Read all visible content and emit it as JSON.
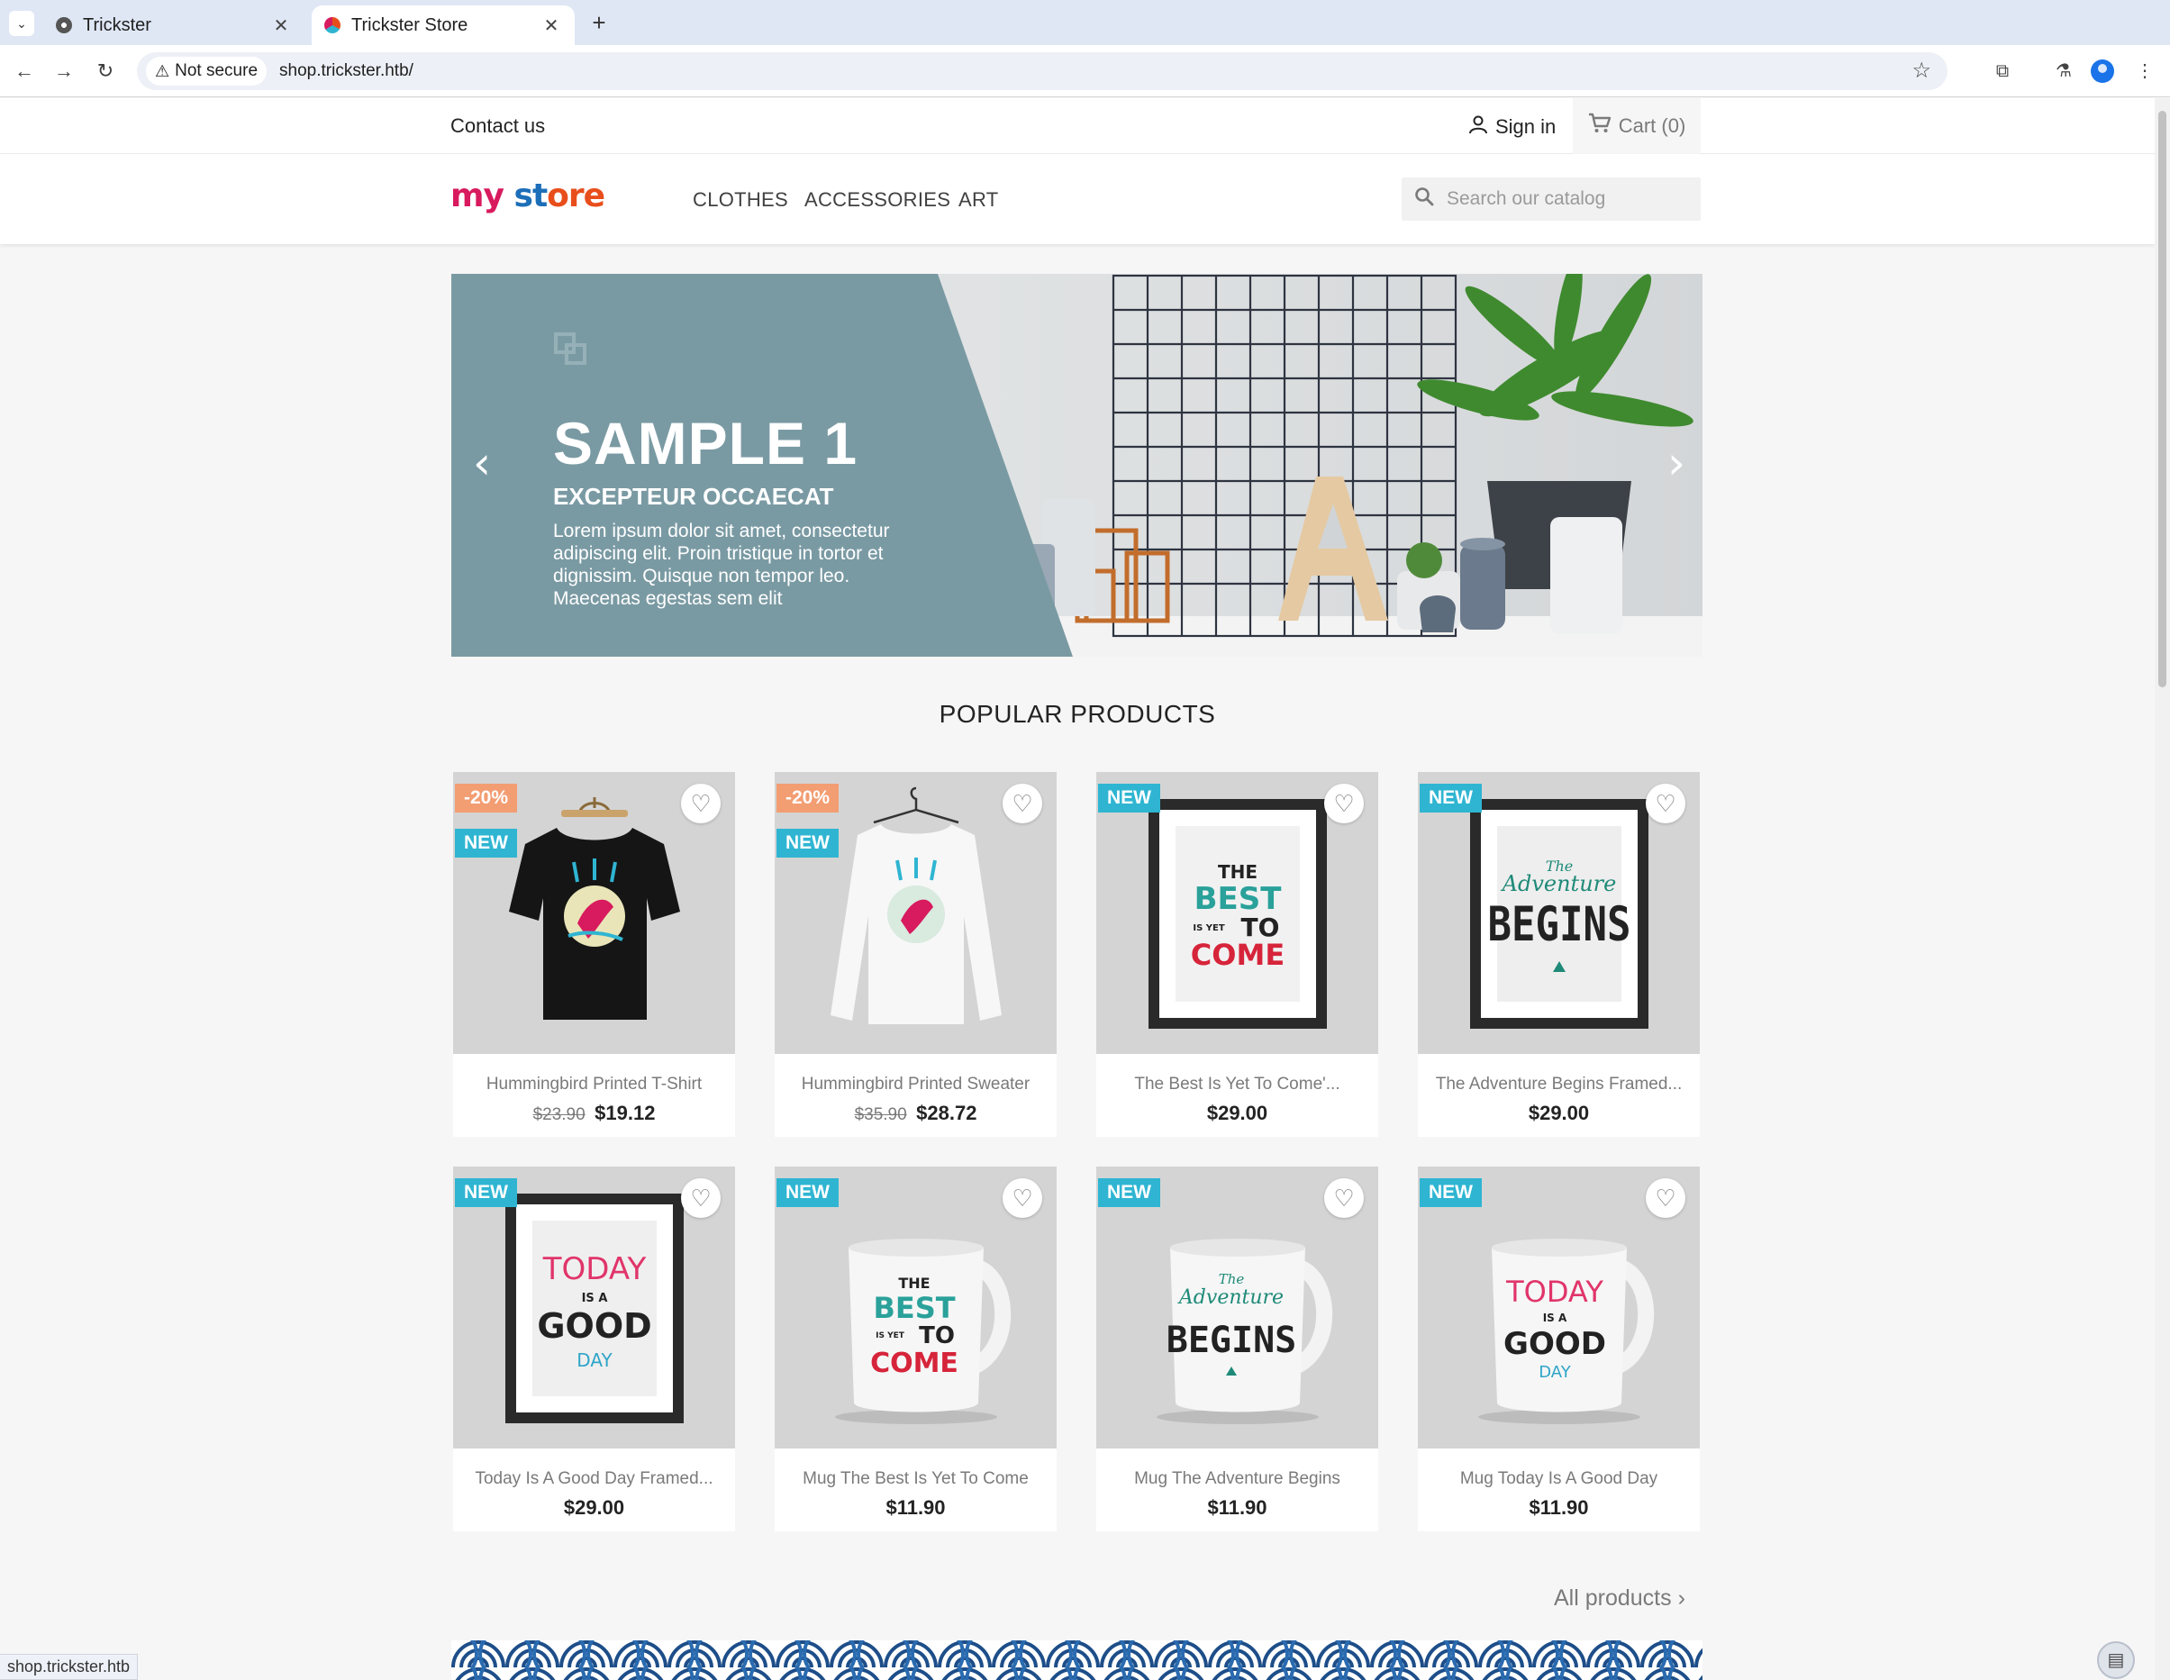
{
  "browser": {
    "tabs": [
      {
        "title": "Trickster",
        "favicon": "globe-icon"
      },
      {
        "title": "Trickster Store",
        "favicon": "store-icon"
      }
    ],
    "security_label": "Not secure",
    "url": "shop.trickster.htb/",
    "status_url": "shop.trickster.htb"
  },
  "header": {
    "contact": "Contact us",
    "sign_in": "Sign in",
    "cart": "Cart (0)"
  },
  "logo": {
    "part1": "my",
    "part2": "st",
    "part3": "ore"
  },
  "menu": [
    "CLOTHES",
    "ACCESSORIES",
    "ART"
  ],
  "search": {
    "placeholder": "Search our catalog",
    "value": ""
  },
  "slider": {
    "title": "SAMPLE 1",
    "subtitle": "EXCEPTEUR OCCAECAT",
    "text": "Lorem ipsum dolor sit amet, consectetur adipiscing elit. Proin tristique in tortor et dignissim. Quisque non tempor leo. Maecenas egestas sem elit",
    "prev_arrow": "‹",
    "next_arrow": "›",
    "panel_color": "#7a9aa3"
  },
  "section_title": "POPULAR PRODUCTS",
  "products": [
    {
      "name": "Hummingbird Printed T-Shirt",
      "old_price": "$23.90",
      "price": "$19.12",
      "discount": "-20%",
      "new": "NEW"
    },
    {
      "name": "Hummingbird Printed Sweater",
      "old_price": "$35.90",
      "price": "$28.72",
      "discount": "-20%",
      "new": "NEW"
    },
    {
      "name": "The Best Is Yet To Come'...",
      "price": "$29.00",
      "new": "NEW"
    },
    {
      "name": "The Adventure Begins Framed...",
      "price": "$29.00",
      "new": "NEW"
    },
    {
      "name": "Today Is A Good Day Framed...",
      "price": "$29.00",
      "new": "NEW"
    },
    {
      "name": "Mug The Best Is Yet To Come",
      "price": "$11.90",
      "new": "NEW"
    },
    {
      "name": "Mug The Adventure Begins",
      "price": "$11.90",
      "new": "NEW"
    },
    {
      "name": "Mug Today Is A Good Day",
      "price": "$11.90",
      "new": "NEW"
    }
  ],
  "artwork": {
    "best": [
      "THE",
      "BEST",
      "IS YET",
      "TO",
      "COME"
    ],
    "adventure": [
      "The",
      "Adventure",
      "BEGINS"
    ],
    "today": [
      "TODAY",
      "IS A",
      "GOOD",
      "DAY"
    ]
  },
  "all_products": "All products",
  "colors": {
    "accent": "#2fb5d2",
    "discount": "#f39d72"
  }
}
